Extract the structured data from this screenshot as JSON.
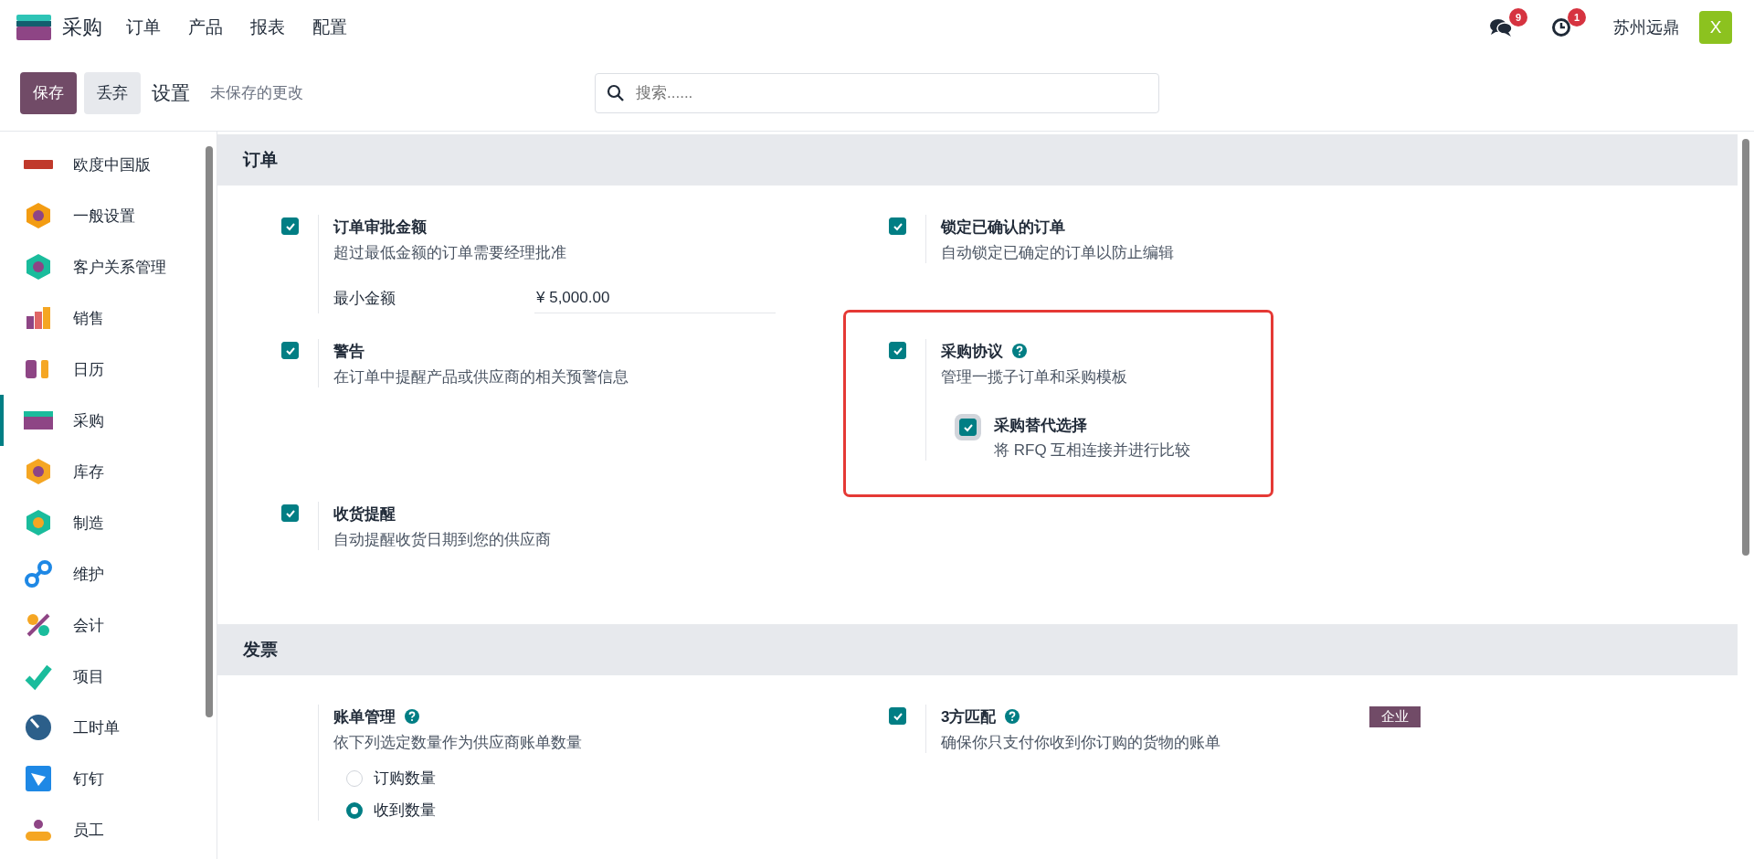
{
  "app": {
    "name": "采购",
    "menu": [
      "订单",
      "产品",
      "报表",
      "配置"
    ]
  },
  "systray": {
    "messages_badge": "9",
    "activities_badge": "1",
    "company": "苏州远鼎",
    "avatar": "X"
  },
  "control_bar": {
    "save": "保存",
    "discard": "丢弃",
    "breadcrumb": "设置",
    "status": "未保存的更改",
    "search": {
      "placeholder": "搜索......"
    }
  },
  "sidebar": {
    "items": [
      {
        "label": "欧度中国版",
        "selected": false
      },
      {
        "label": "一般设置",
        "selected": false
      },
      {
        "label": "客户关系管理",
        "selected": false
      },
      {
        "label": "销售",
        "selected": false
      },
      {
        "label": "日历",
        "selected": false
      },
      {
        "label": "采购",
        "selected": true
      },
      {
        "label": "库存",
        "selected": false
      },
      {
        "label": "制造",
        "selected": false
      },
      {
        "label": "维护",
        "selected": false
      },
      {
        "label": "会计",
        "selected": false
      },
      {
        "label": "项目",
        "selected": false
      },
      {
        "label": "工时单",
        "selected": false
      },
      {
        "label": "钉钉",
        "selected": false
      },
      {
        "label": "员工",
        "selected": false
      }
    ]
  },
  "sections": [
    {
      "title": "订单",
      "settings": [
        {
          "kind": "checkbox",
          "checked": true,
          "label": "订单审批金额",
          "help": false,
          "highlighted": false,
          "description": "超过最低金额的订单需要经理批准",
          "field": {
            "label": "最小金额",
            "value": "¥ 5,000.00"
          }
        },
        {
          "kind": "checkbox",
          "checked": true,
          "label": "锁定已确认的订单",
          "help": false,
          "highlighted": false,
          "description": "自动锁定已确定的订单以防止编辑"
        },
        {
          "kind": "checkbox",
          "checked": true,
          "label": "警告",
          "help": false,
          "highlighted": false,
          "description": "在订单中提醒产品或供应商的相关预警信息"
        },
        {
          "kind": "checkbox",
          "checked": true,
          "label": "采购协议",
          "help": true,
          "highlighted": true,
          "description": "管理一揽子订单和采购模板",
          "sub": {
            "checked": true,
            "focused": true,
            "label": "采购替代选择",
            "description": "将 RFQ 互相连接并进行比较"
          }
        },
        {
          "kind": "checkbox",
          "checked": true,
          "label": "收货提醒",
          "help": false,
          "highlighted": false,
          "description": "自动提醒收货日期到您的供应商"
        }
      ]
    },
    {
      "title": "发票",
      "settings": [
        {
          "kind": "radio",
          "label": "账单管理",
          "help": true,
          "highlighted": false,
          "description": "依下列选定数量作为供应商账单数量",
          "options": [
            {
              "label": "订购数量",
              "selected": false
            },
            {
              "label": "收到数量",
              "selected": true
            }
          ]
        },
        {
          "kind": "checkbox",
          "checked": true,
          "label": "3方匹配",
          "help": true,
          "highlighted": false,
          "description": "确保你只支付你收到你订购的货物的账单",
          "badge": "企业"
        }
      ]
    }
  ]
}
